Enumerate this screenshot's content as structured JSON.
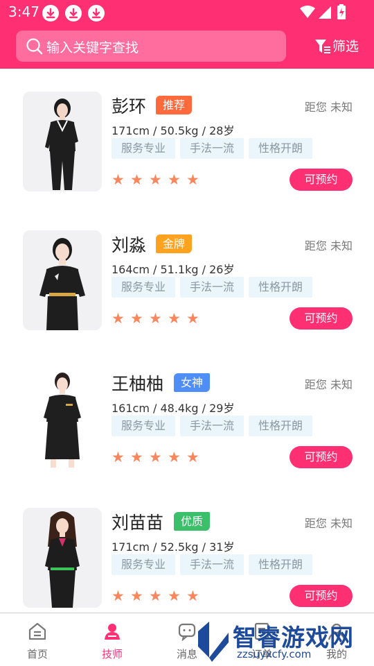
{
  "status_bar": {
    "time": "3:47"
  },
  "search": {
    "placeholder": "输入关键字查找"
  },
  "filter": {
    "label": "筛选"
  },
  "colors": {
    "brand": "#ff2f74",
    "star": "#f8875d",
    "tag_bg": "#eaf6fb"
  },
  "technicians": [
    {
      "name": "彭环",
      "badge": "推荐",
      "badge_color": "#ff6a3d",
      "distance": "距您 未知",
      "stats": "171cm / 50.5kg / 28岁",
      "tags": [
        "服务专业",
        "手法一流",
        "性格开朗"
      ],
      "rating": 5,
      "stars": [
        "★",
        "★",
        "★",
        "★",
        "★"
      ],
      "action": "可预约"
    },
    {
      "name": "刘淼",
      "badge": "金牌",
      "badge_color": "#ffa21f",
      "distance": "距您 未知",
      "stats": "164cm / 51.1kg / 26岁",
      "tags": [
        "服务专业",
        "手法一流",
        "性格开朗"
      ],
      "rating": 5,
      "stars": [
        "★",
        "★",
        "★",
        "★",
        "★"
      ],
      "action": "可预约"
    },
    {
      "name": "王柚柚",
      "badge": "女神",
      "badge_color": "#4f8ef6",
      "distance": "距您 未知",
      "stats": "161cm / 48.4kg / 29岁",
      "tags": [
        "服务专业",
        "手法一流",
        "性格开朗"
      ],
      "rating": 5,
      "stars": [
        "★",
        "★",
        "★",
        "★",
        "★"
      ],
      "action": "可预约"
    },
    {
      "name": "刘苗苗",
      "badge": "优质",
      "badge_color": "#3cbf6a",
      "distance": "距您 未知",
      "stats": "171cm / 52.5kg / 31岁",
      "tags": [
        "服务专业",
        "手法一流",
        "性格开朗"
      ],
      "rating": 5,
      "stars": [
        "★",
        "★",
        "★",
        "★",
        "★"
      ],
      "action": "可预约"
    }
  ],
  "tabs": [
    {
      "label": "首页",
      "icon": "home-icon"
    },
    {
      "label": "技师",
      "icon": "technician-icon",
      "active": true
    },
    {
      "label": "消息",
      "icon": "message-icon"
    },
    {
      "label": "订单",
      "icon": "order-icon"
    },
    {
      "label": "我的",
      "icon": "profile-icon"
    }
  ],
  "watermark": {
    "text": "智睿游戏网",
    "url": "zzsuyxcfy.com"
  }
}
